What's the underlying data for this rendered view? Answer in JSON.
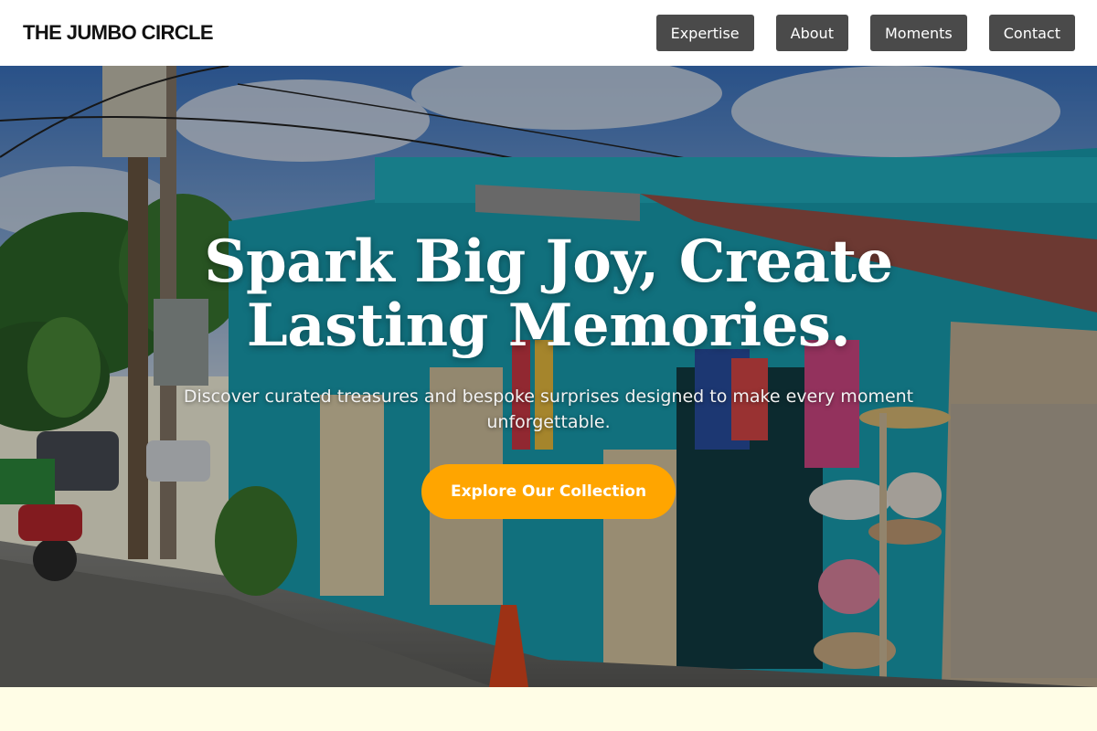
{
  "header": {
    "brand": "THE JUMBO CIRCLE",
    "nav": [
      {
        "label": "Expertise"
      },
      {
        "label": "About"
      },
      {
        "label": "Moments"
      },
      {
        "label": "Contact"
      }
    ]
  },
  "hero": {
    "title": "Spark Big Joy, Create Lasting Memories.",
    "subtitle": "Discover curated treasures and bespoke surprises designed to make every moment unforgettable.",
    "cta_label": "Explore Our Collection",
    "background_image": "colorful-souvenir-shop-street-scene"
  },
  "colors": {
    "nav_button_bg": "#4a4a4a",
    "cta_bg": "#ffa500",
    "page_bg": "#fffde6",
    "header_bg": "#ffffff"
  }
}
